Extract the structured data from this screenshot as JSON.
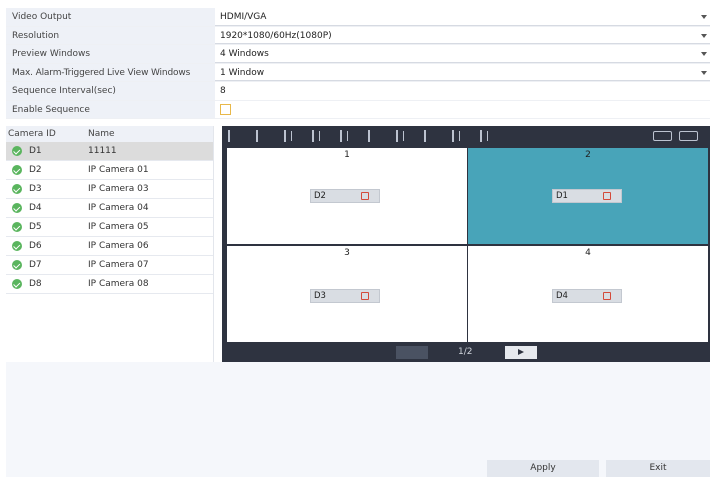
{
  "settings": {
    "video_output": {
      "label": "Video Output",
      "value": "HDMI/VGA"
    },
    "resolution": {
      "label": "Resolution",
      "value": "1920*1080/60Hz(1080P)"
    },
    "preview_windows": {
      "label": "Preview Windows",
      "value": "4 Windows"
    },
    "max_alarm": {
      "label": "Max. Alarm-Triggered Live View Windows",
      "value": "1 Window"
    },
    "sequence_interval": {
      "label": "Sequence Interval(sec)",
      "value": "8"
    },
    "enable_sequence": {
      "label": "Enable Sequence",
      "checked": false
    }
  },
  "camera_table": {
    "headers": {
      "id": "Camera ID",
      "name": "Name"
    },
    "rows": [
      {
        "id": "D1",
        "name": "11111",
        "selected": true
      },
      {
        "id": "D2",
        "name": "IP Camera 01"
      },
      {
        "id": "D3",
        "name": "IP Camera 03"
      },
      {
        "id": "D4",
        "name": "IP Camera 04"
      },
      {
        "id": "D5",
        "name": "IP Camera 05"
      },
      {
        "id": "D6",
        "name": "IP Camera 06"
      },
      {
        "id": "D7",
        "name": "IP Camera 07"
      },
      {
        "id": "D8",
        "name": "IP Camera 08"
      }
    ]
  },
  "preview": {
    "cells": [
      {
        "number": "1",
        "camera": "D2"
      },
      {
        "number": "2",
        "camera": "D1",
        "active": true
      },
      {
        "number": "3",
        "camera": "D3"
      },
      {
        "number": "4",
        "camera": "D4"
      }
    ],
    "page": "1/2",
    "accent_color": "#48a4b9"
  },
  "buttons": {
    "apply": "Apply",
    "exit": "Exit"
  }
}
